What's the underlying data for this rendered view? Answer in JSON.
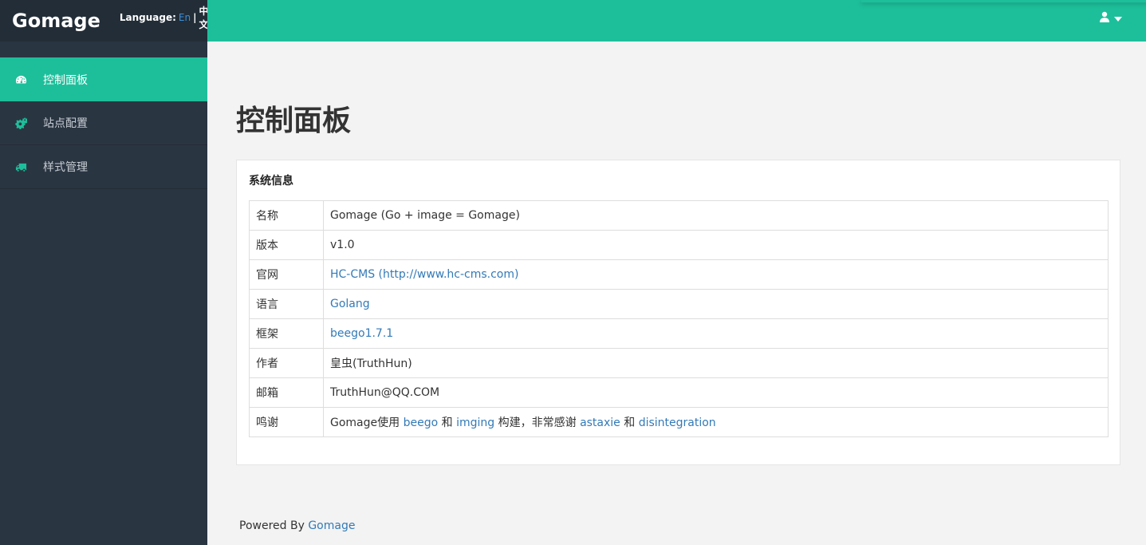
{
  "app": {
    "brand": "Gomage"
  },
  "language": {
    "label": "Language:",
    "en": "En",
    "separator": "|",
    "zh": "中文"
  },
  "nav": {
    "items": [
      {
        "label": "控制面板",
        "icon": "dashboard-icon",
        "active": true
      },
      {
        "label": "站点配置",
        "icon": "gears-icon",
        "active": false
      },
      {
        "label": "样式管理",
        "icon": "truck-icon",
        "active": false
      }
    ]
  },
  "topbar": {
    "user_icon": "user-icon",
    "dropdown_icon": "caret-down-icon"
  },
  "page": {
    "title": "控制面板"
  },
  "panel": {
    "title": "系统信息",
    "rows": [
      {
        "key": "名称",
        "value": "Gomage (Go + image = Gomage)"
      },
      {
        "key": "版本",
        "value": "v1.0"
      },
      {
        "key": "官网",
        "value": "HC-CMS (http://www.hc-cms.com)"
      },
      {
        "key": "语言",
        "value": "Golang"
      },
      {
        "key": "框架",
        "value": "beego1.7.1"
      },
      {
        "key": "作者",
        "value": "皇虫(TruthHun)"
      },
      {
        "key": "邮箱",
        "value": "TruthHun@QQ.COM"
      },
      {
        "key": "鸣谢",
        "parts": {
          "t1": "Gomage使用 ",
          "l1": "beego",
          "t2": " 和 ",
          "l2": "imging",
          "t3": " 构建，非常感谢 ",
          "l3": "astaxie",
          "t4": " 和 ",
          "l4": "disintegration"
        }
      }
    ]
  },
  "footer": {
    "text": "Powered By ",
    "link": "Gomage"
  },
  "colors": {
    "accent": "#1dbf9b",
    "sidebar": "#2a3542",
    "brand_bar": "#222d37",
    "link": "#337ab7"
  }
}
